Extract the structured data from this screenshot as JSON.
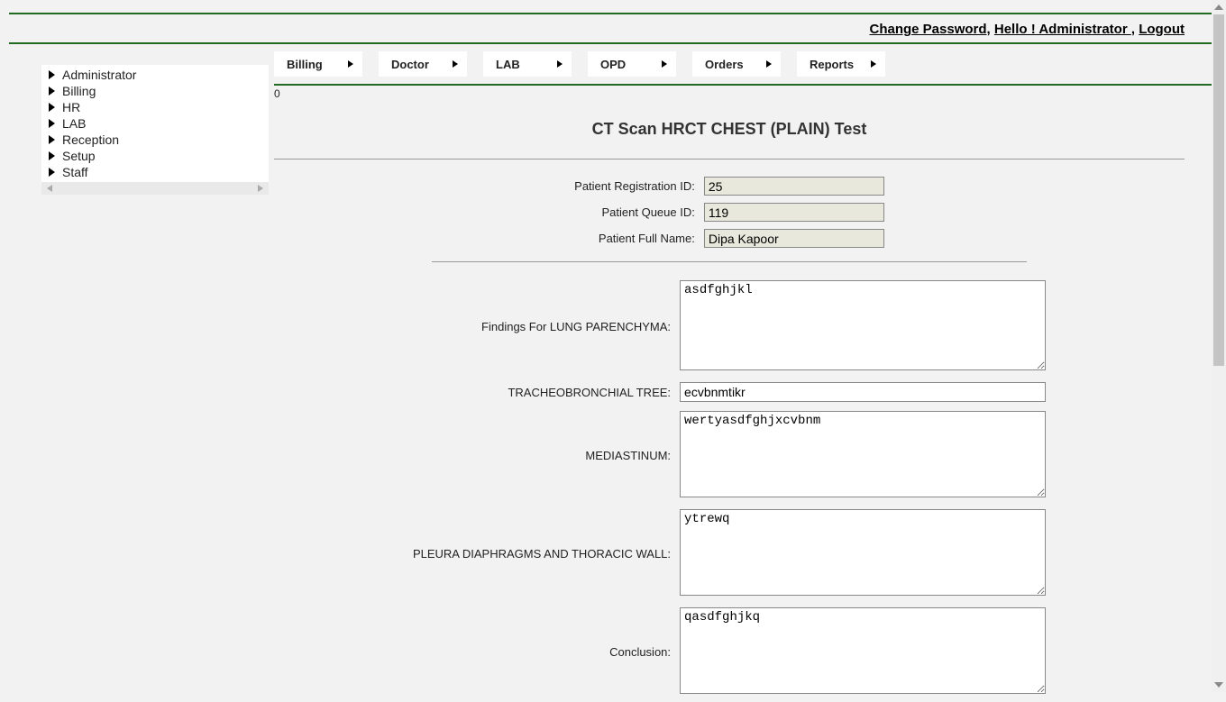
{
  "header": {
    "change_password": "Change Password",
    "greeting": "Hello ! Administrator ",
    "logout": "Logout",
    "sep1": ", ",
    "sep2": ", "
  },
  "sidebar": {
    "items": [
      {
        "label": "Administrator"
      },
      {
        "label": "Billing"
      },
      {
        "label": "HR"
      },
      {
        "label": "LAB"
      },
      {
        "label": "Reception"
      },
      {
        "label": "Setup"
      },
      {
        "label": "Staff"
      }
    ]
  },
  "topnav": {
    "items": [
      {
        "label": "Billing"
      },
      {
        "label": "Doctor"
      },
      {
        "label": "LAB"
      },
      {
        "label": "OPD"
      },
      {
        "label": "Orders"
      },
      {
        "label": "Reports"
      }
    ]
  },
  "main": {
    "zero_indicator": "0",
    "title": "CT Scan HRCT CHEST (PLAIN) Test",
    "info": {
      "reg_id_label": "Patient Registration ID:",
      "reg_id_value": "25",
      "queue_id_label": "Patient Queue ID:",
      "queue_id_value": "119",
      "full_name_label": "Patient Full Name:",
      "full_name_value": "Dipa Kapoor"
    },
    "fields": [
      {
        "label": "Findings For LUNG PARENCHYMA:",
        "value": "asdfghjkl",
        "type": "textarea_tall"
      },
      {
        "label": "TRACHEOBRONCHIAL TREE:",
        "value": "ecvbnmtikr",
        "type": "input"
      },
      {
        "label": "MEDIASTINUM:",
        "value": "wertyasdfghjxcvbnm",
        "type": "textarea_med"
      },
      {
        "label": "PLEURA DIAPHRAGMS AND THORACIC WALL:",
        "value": "ytrewq",
        "type": "textarea_med"
      },
      {
        "label": "Conclusion:",
        "value": "qasdfghjkq",
        "type": "textarea_med"
      }
    ]
  }
}
